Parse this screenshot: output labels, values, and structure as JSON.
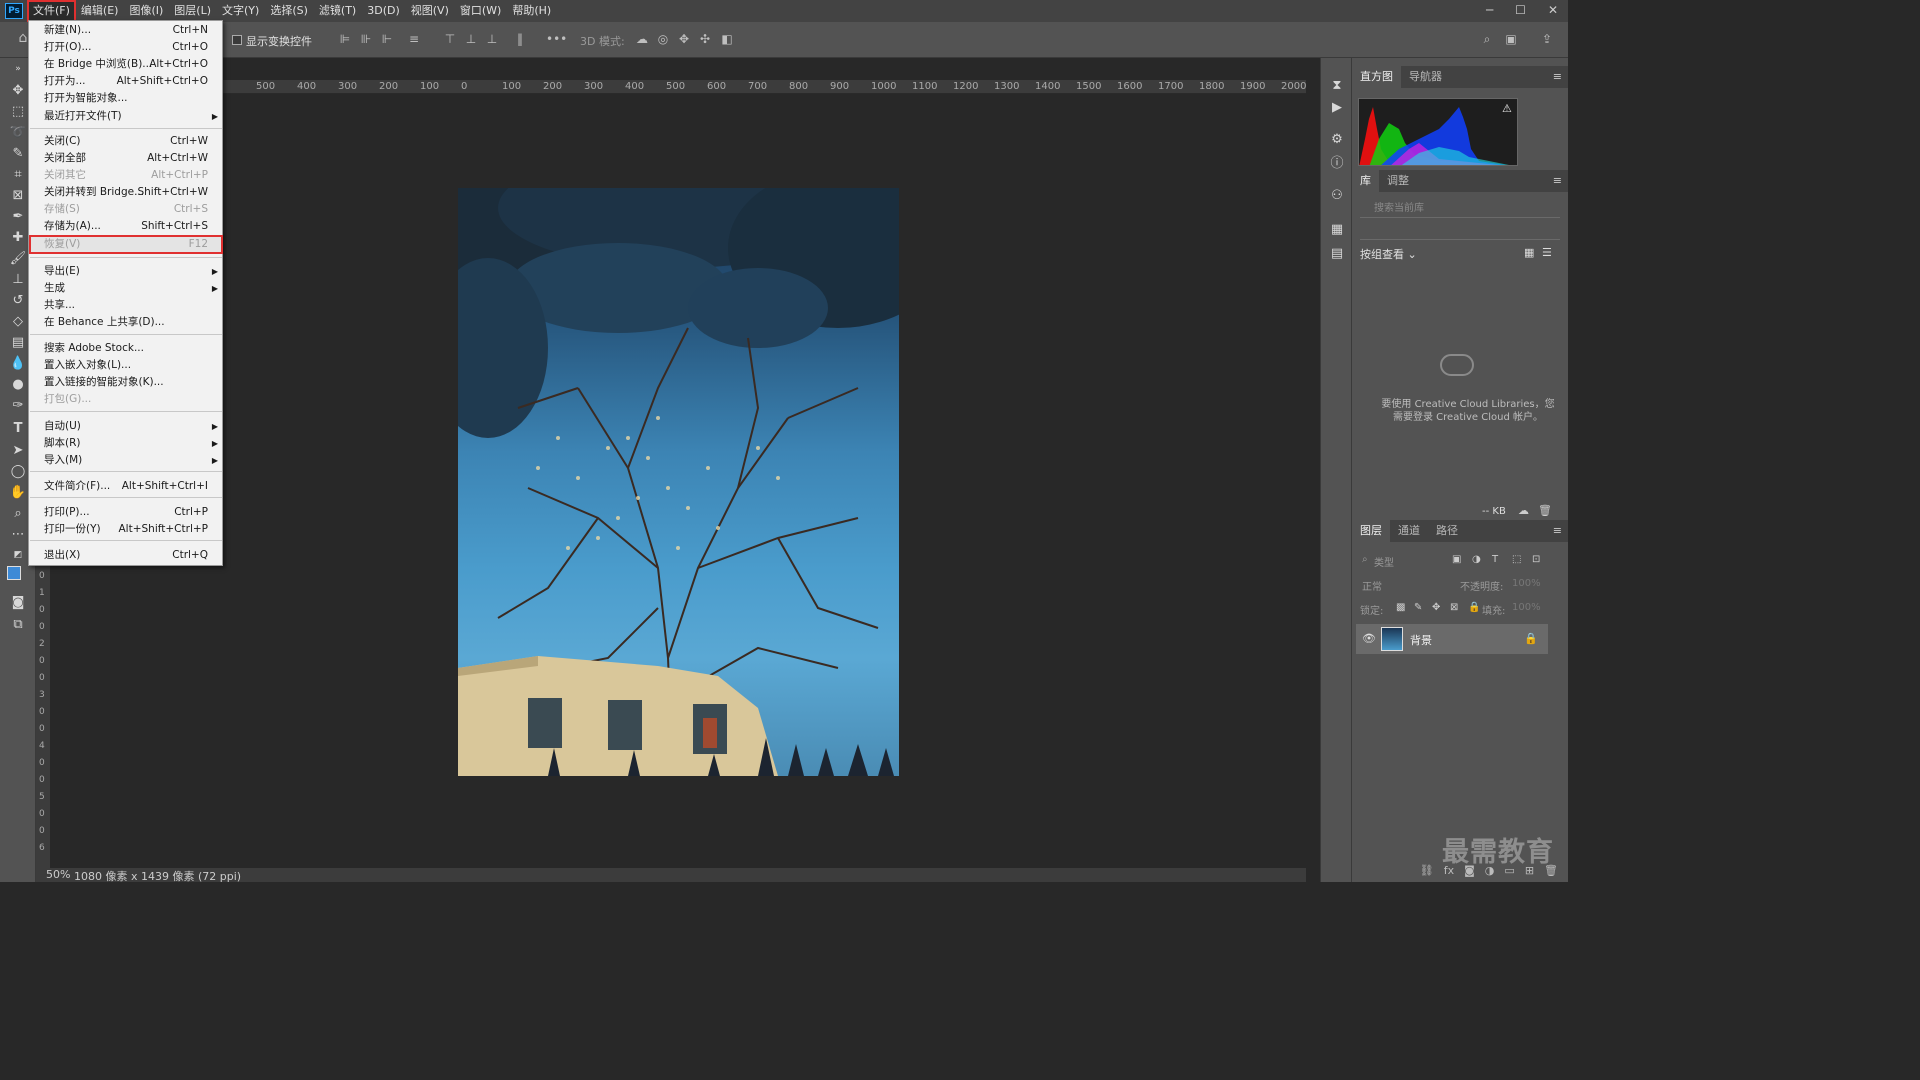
{
  "app": {
    "logo": "Ps"
  },
  "menubar": {
    "items": [
      "文件(F)",
      "编辑(E)",
      "图像(I)",
      "图层(L)",
      "文字(Y)",
      "选择(S)",
      "滤镜(T)",
      "3D(D)",
      "视图(V)",
      "窗口(W)",
      "帮助(H)"
    ]
  },
  "window_controls": {
    "minimize": "─",
    "maximize": "☐",
    "close": "✕"
  },
  "options_bar": {
    "show_transform_label": "显示变换控件",
    "more": "•••",
    "mode_3d_label": "3D 模式:"
  },
  "ruler": {
    "top_ticks": [
      "500",
      "400",
      "300",
      "200",
      "100",
      "0",
      "100",
      "200",
      "300",
      "400",
      "500",
      "600",
      "700",
      "800",
      "900",
      "1000",
      "1100",
      "1200",
      "1300",
      "1400",
      "1500",
      "1600",
      "1700",
      "1800",
      "1900",
      "2000"
    ],
    "left_ticks": [
      "0",
      "1",
      "0",
      "0",
      "2",
      "0",
      "0",
      "3",
      "0",
      "0",
      "4",
      "0",
      "0",
      "5",
      "0",
      "0",
      "6"
    ]
  },
  "status": {
    "zoom": "50%",
    "doc_info": "1080 像素 x 1439 像素 (72 ppi)"
  },
  "file_menu": {
    "items": [
      {
        "label": "新建(N)...",
        "shortcut": "Ctrl+N"
      },
      {
        "label": "打开(O)...",
        "shortcut": "Ctrl+O"
      },
      {
        "label": "在 Bridge 中浏览(B)...",
        "shortcut": "Alt+Ctrl+O"
      },
      {
        "label": "打开为...",
        "shortcut": "Alt+Shift+Ctrl+O"
      },
      {
        "label": "打开为智能对象...",
        "shortcut": ""
      },
      {
        "label": "最近打开文件(T)",
        "shortcut": "",
        "submenu": "▶"
      },
      {
        "label": "关闭(C)",
        "shortcut": "Ctrl+W"
      },
      {
        "label": "关闭全部",
        "shortcut": "Alt+Ctrl+W"
      },
      {
        "label": "关闭其它",
        "shortcut": "Alt+Ctrl+P",
        "disabled": true
      },
      {
        "label": "关闭并转到 Bridge...",
        "shortcut": "Shift+Ctrl+W"
      },
      {
        "label": "存储(S)",
        "shortcut": "Ctrl+S",
        "disabled": true
      },
      {
        "label": "存储为(A)...",
        "shortcut": "Shift+Ctrl+S"
      },
      {
        "label": "恢复(V)",
        "shortcut": "F12",
        "disabled": true
      },
      {
        "label": "导出(E)",
        "shortcut": "",
        "submenu": "▶"
      },
      {
        "label": "生成",
        "shortcut": "",
        "submenu": "▶"
      },
      {
        "label": "共享...",
        "shortcut": ""
      },
      {
        "label": "在 Behance 上共享(D)...",
        "shortcut": ""
      },
      {
        "label": "搜索 Adobe Stock...",
        "shortcut": ""
      },
      {
        "label": "置入嵌入对象(L)...",
        "shortcut": ""
      },
      {
        "label": "置入链接的智能对象(K)...",
        "shortcut": ""
      },
      {
        "label": "打包(G)...",
        "shortcut": "",
        "disabled": true
      },
      {
        "label": "自动(U)",
        "shortcut": "",
        "submenu": "▶"
      },
      {
        "label": "脚本(R)",
        "shortcut": "",
        "submenu": "▶"
      },
      {
        "label": "导入(M)",
        "shortcut": "",
        "submenu": "▶"
      },
      {
        "label": "文件简介(F)...",
        "shortcut": "Alt+Shift+Ctrl+I"
      },
      {
        "label": "打印(P)...",
        "shortcut": "Ctrl+P"
      },
      {
        "label": "打印一份(Y)",
        "shortcut": "Alt+Shift+Ctrl+P"
      },
      {
        "label": "退出(X)",
        "shortcut": "Ctrl+Q"
      }
    ]
  },
  "panels": {
    "histogram_tabs": [
      "直方图",
      "导航器"
    ],
    "histogram_warning": "⚠",
    "library_tabs": [
      "库",
      "调整"
    ],
    "library_search_placeholder": "搜索当前库",
    "library_view": "按组查看 ⌄",
    "cc_message_1": "要使用 Creative Cloud Libraries，您",
    "cc_message_2": "需要登录 Creative Cloud 帐户。",
    "library_size": "-- KB",
    "layers_tabs": [
      "图层",
      "通道",
      "路径"
    ],
    "layer_filter": "类型",
    "blend_mode": "正常",
    "opacity_label": "不透明度:",
    "opacity_value": "100%",
    "lock_label": "锁定:",
    "fill_label": "填充:",
    "fill_value": "100%",
    "layer_name": "背景"
  },
  "watermark": "最需教育",
  "colors": {
    "menu_highlight_border": "#e03030",
    "ps_blue": "#31a8ff"
  }
}
